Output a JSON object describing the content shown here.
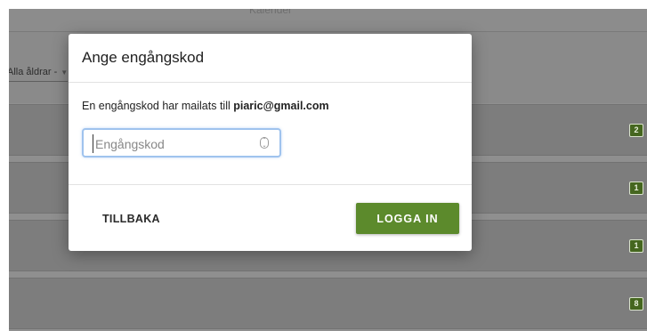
{
  "background": {
    "topbar_title": "Kalender",
    "age_filter": {
      "label": "Alla åldrar -"
    },
    "rows": [
      {
        "badge": "2"
      },
      {
        "badge": "1"
      },
      {
        "badge": "1"
      },
      {
        "badge": "8"
      }
    ]
  },
  "dialog": {
    "title": "Ange engångskod",
    "message_prefix": "En engångskod har mailats till ",
    "email": "piaric@gmail.com",
    "code_input": {
      "value": "",
      "placeholder": "Engångskod"
    },
    "back_label": "TILLBAKA",
    "login_label": "LOGGA IN"
  },
  "colors": {
    "accent_green": "#5c8a2c",
    "badge_green": "#45661f",
    "overlay_gray": "#8f8f8f",
    "focus_blue": "#9fc3ee"
  }
}
